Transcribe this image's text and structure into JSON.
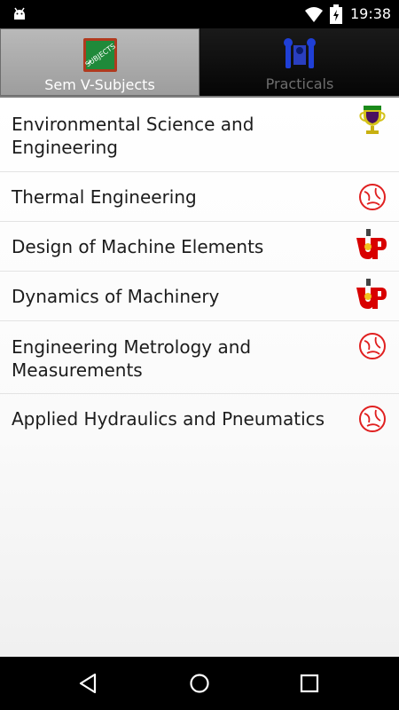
{
  "status_bar": {
    "time": "19:38",
    "icons": [
      "android-icon",
      "wifi-icon",
      "battery-charging-icon"
    ]
  },
  "tabs": [
    {
      "label": "Sem V-Subjects",
      "icon": "subjects-chalkboard-icon",
      "selected": true
    },
    {
      "label": "Practicals",
      "icon": "tools-icon",
      "selected": false
    }
  ],
  "subjects": [
    {
      "label": "Environmental Science and Engineering",
      "icon": "trophy-icon"
    },
    {
      "label": "Thermal Engineering",
      "icon": "ball-icon"
    },
    {
      "label": "Design of Machine Elements",
      "icon": "up-icon"
    },
    {
      "label": "Dynamics of Machinery",
      "icon": "up-icon"
    },
    {
      "label": "Engineering Metrology and Measurements",
      "icon": "ball-icon"
    },
    {
      "label": "Applied Hydraulics and Pneumatics",
      "icon": "ball-icon"
    }
  ],
  "nav_bar": {
    "buttons": [
      "back-icon",
      "home-icon",
      "recents-icon"
    ]
  },
  "colors": {
    "selected_tab": "#a9a9a9",
    "tab_bar": "#111111",
    "trophy_gold": "#d4c21a",
    "ball_red": "#e02020",
    "up_red": "#d80000"
  }
}
